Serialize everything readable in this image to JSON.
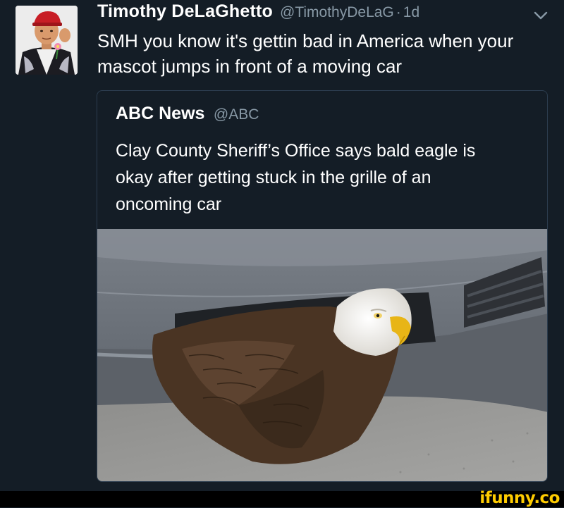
{
  "tweet": {
    "author_name": "Timothy DeLaGhetto",
    "author_handle": "@TimothyDeLaG",
    "separator": "·",
    "time": "1d",
    "text": "SMH you know it's gettin bad in America when your mascot jumps in front of a moving car",
    "menu_icon": "chevron-down-icon"
  },
  "quoted_tweet": {
    "author_name": "ABC News",
    "author_handle": "@ABC",
    "text": "Clay County Sheriff’s Office says bald eagle is okay after getting stuck in the grille of an oncoming car"
  },
  "footer": {
    "watermark": "ifunny.co"
  },
  "colors": {
    "background": "#141d26",
    "secondary_text": "#8899a6",
    "card_border": "#2c3d4f",
    "watermark": "#ffcc00"
  }
}
